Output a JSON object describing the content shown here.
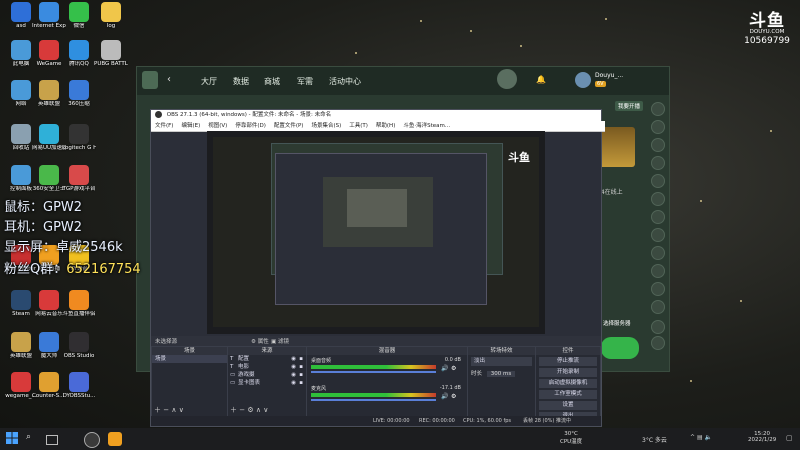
{
  "desktop_icons": [
    {
      "label": "asd",
      "color": "#2e6fd8"
    },
    {
      "label": "Internet Explorer",
      "color": "#3a8be0"
    },
    {
      "label": "微信",
      "color": "#35c04a"
    },
    {
      "label": "log",
      "color": "#f0c64a"
    },
    {
      "label": "此电脑",
      "color": "#4a9ad8"
    },
    {
      "label": "WeGame",
      "color": "#d83a3a"
    },
    {
      "label": "腾讯QQ",
      "color": "#2f8fe0"
    },
    {
      "label": "PUBG BATTLEGR...",
      "color": "#bbbbbb"
    },
    {
      "label": "网络",
      "color": "#4a9ad8"
    },
    {
      "label": "英雄联盟",
      "color": "#c8a24a"
    },
    {
      "label": "360压缩",
      "color": "#3a7ad8"
    },
    {
      "label": "回收站",
      "color": "#8aa0b0"
    },
    {
      "label": "网易UU加速器",
      "color": "#2fb0d8"
    },
    {
      "label": "Logitech G HUB",
      "color": "#333333"
    },
    {
      "label": "控制面板",
      "color": "#4a9ad8"
    },
    {
      "label": "360安全卫士",
      "color": "#4ab84a"
    },
    {
      "label": "TGP游戏平台",
      "color": "#d84a4a"
    },
    {
      "label": "MSI Center",
      "color": "#c83030"
    },
    {
      "label": "斗鱼直播",
      "color": "#f0a020"
    },
    {
      "label": "YY语音",
      "color": "#f0c020"
    },
    {
      "label": "Steam",
      "color": "#2a4a70"
    },
    {
      "label": "网易云音乐",
      "color": "#d83a3a"
    },
    {
      "label": "斗鱼直播伴侣",
      "color": "#f08a20"
    },
    {
      "label": "英雄联盟",
      "color": "#c8a24a"
    },
    {
      "label": "魔大师",
      "color": "#3a7ad8"
    },
    {
      "label": "OBS Studio",
      "color": "#302e31"
    },
    {
      "label": "wegame_...",
      "color": "#d83a3a"
    },
    {
      "label": "Counter-S... Global Offe...",
      "color": "#e0a030"
    },
    {
      "label": "DYOBSStu...",
      "color": "#4a6ad8"
    }
  ],
  "overlay": {
    "mouse": "鼠标：GPW2",
    "earphone": "耳机：",
    "earphone_val": "GPW2",
    "monitor": "显示屏：卓威2546k",
    "fans": "粉丝Q群：",
    "fans_val": "652167754"
  },
  "brand": {
    "logo": "斗鱼",
    "site": "DOUYU.COM",
    "room_id": "10569799"
  },
  "douyu": {
    "nav": [
      "大厅",
      "数据",
      "商城",
      "军需",
      "活动中心"
    ],
    "user": "Douyu_...",
    "level": "6V",
    "open_btn": "我要开播",
    "side_text": "44在线上",
    "bottom_btn": "选择服务器"
  },
  "obs": {
    "title": "OBS 27.1.3 (64-bit, windows) - 配置文件: 未命名 - 场景: 未命名",
    "menu": [
      "文件(F)",
      "编辑(E)",
      "视图(V)",
      "停靠部件(D)",
      "配置文件(P)",
      "场景集合(S)",
      "工具(T)",
      "帮助(H)",
      "斗鱼·海洋Steam..."
    ],
    "no_source": "未选择源",
    "props_btn": "属性",
    "filter_btn": "滤镜",
    "panels": {
      "scenes": "场景",
      "sources": "来源",
      "mixer": "混音器",
      "transitions": "转场特效",
      "controls": "控件"
    },
    "scene_items": [
      "场景"
    ],
    "source_items": [
      "配置",
      "电影",
      "游戏摄",
      "显卡图表"
    ],
    "mixer_tracks": [
      {
        "name": "桌面音频",
        "db": "0.0 dB"
      },
      {
        "name": "麦克风",
        "db": "-17.1 dB"
      }
    ],
    "transition": {
      "type": "淡出",
      "duration_label": "时长",
      "duration": "300 ms"
    },
    "controls": [
      "停止推流",
      "开始录制",
      "启动虚拟摄像机",
      "工作室模式",
      "设置",
      "退出"
    ],
    "status": {
      "live": "LIVE: 00:00:00",
      "rec": "REC: 00:00:00",
      "cpu": "CPU: 1%, 60.00 fps",
      "dropped": "丢帧 28 (0%) 推流中"
    }
  },
  "taskbar": {
    "weather": "30°C",
    "weather_sub": "CPU温度",
    "temp": "3°C 多云",
    "time": "15:20",
    "date": "2022/1/29"
  }
}
